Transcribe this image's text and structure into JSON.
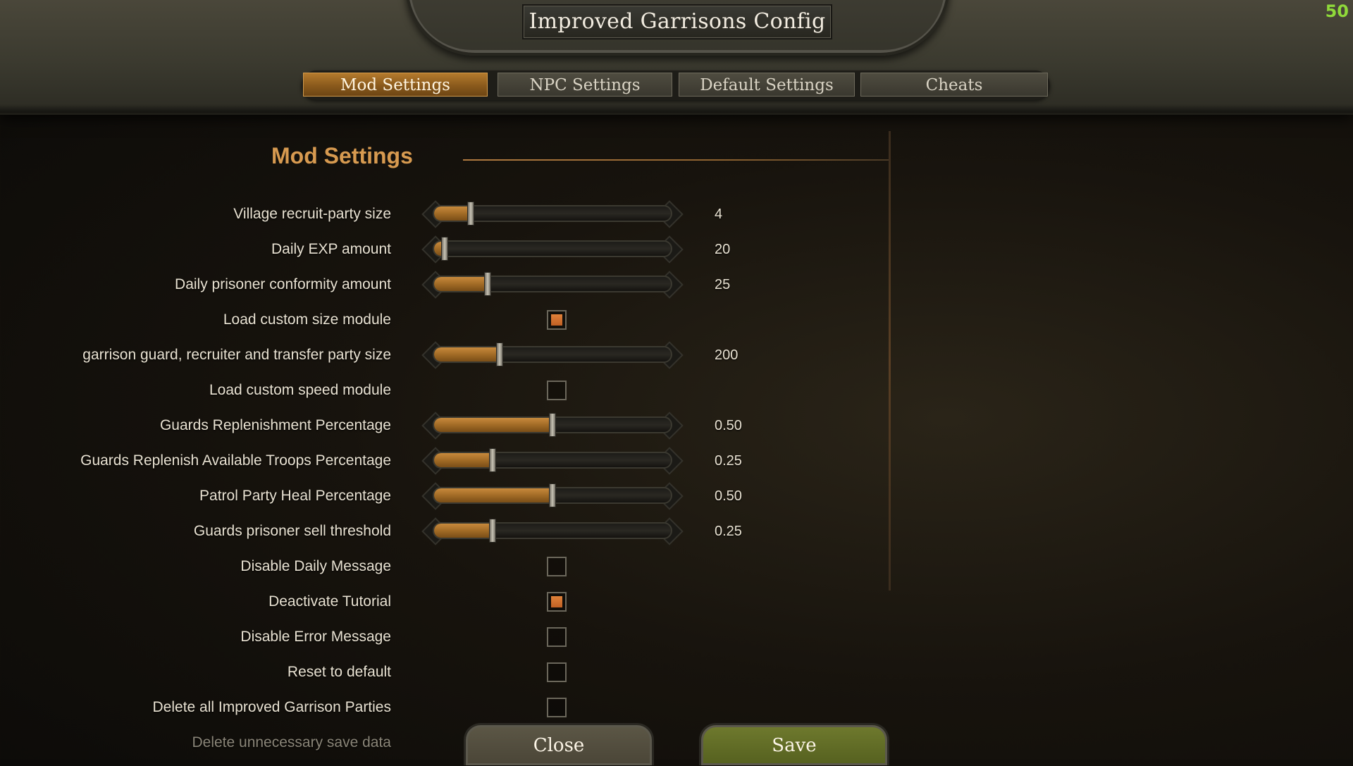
{
  "window": {
    "title": "Improved Garrisons Config",
    "fps": "50"
  },
  "tabs": [
    {
      "label": "Mod Settings",
      "active": true
    },
    {
      "label": "NPC Settings",
      "active": false
    },
    {
      "label": "Default Settings",
      "active": false
    },
    {
      "label": "Cheats",
      "active": false
    }
  ],
  "section": {
    "title": "Mod Settings"
  },
  "settings": [
    {
      "label": "Village recruit-party size",
      "type": "slider",
      "value": "4",
      "level": 0.16
    },
    {
      "label": "Daily EXP amount",
      "type": "slider",
      "value": "20",
      "level": 0.05
    },
    {
      "label": "Daily prisoner conformity amount",
      "type": "slider",
      "value": "25",
      "level": 0.23
    },
    {
      "label": "Load custom size module",
      "type": "checkbox",
      "checked": true
    },
    {
      "label": "garrison guard, recruiter and transfer party size",
      "type": "slider",
      "value": "200",
      "level": 0.28
    },
    {
      "label": "Load custom speed module",
      "type": "checkbox",
      "checked": false
    },
    {
      "label": "Guards Replenishment Percentage",
      "type": "slider",
      "value": "0.50",
      "level": 0.5
    },
    {
      "label": "Guards Replenish Available Troops Percentage",
      "type": "slider",
      "value": "0.25",
      "level": 0.25
    },
    {
      "label": "Patrol Party Heal Percentage",
      "type": "slider",
      "value": "0.50",
      "level": 0.5
    },
    {
      "label": "Guards prisoner sell threshold",
      "type": "slider",
      "value": "0.25",
      "level": 0.25
    },
    {
      "label": "Disable Daily Message",
      "type": "checkbox",
      "checked": false
    },
    {
      "label": "Deactivate Tutorial",
      "type": "checkbox",
      "checked": true
    },
    {
      "label": "Disable Error Message",
      "type": "checkbox",
      "checked": false
    },
    {
      "label": "Reset to default",
      "type": "checkbox",
      "checked": false
    },
    {
      "label": "Delete all Improved Garrison Parties",
      "type": "checkbox",
      "checked": false
    },
    {
      "label": "Delete unnecessary save data",
      "type": "checkbox",
      "checked": false
    }
  ],
  "buttons": {
    "close": "Close",
    "save": "Save"
  },
  "colors": {
    "accent": "#d79a50",
    "slider_fill": "#a26b26",
    "checkbox_checked": "#e0823a",
    "save_button": "#6f7a2e",
    "fps_counter": "#8fd93a"
  }
}
